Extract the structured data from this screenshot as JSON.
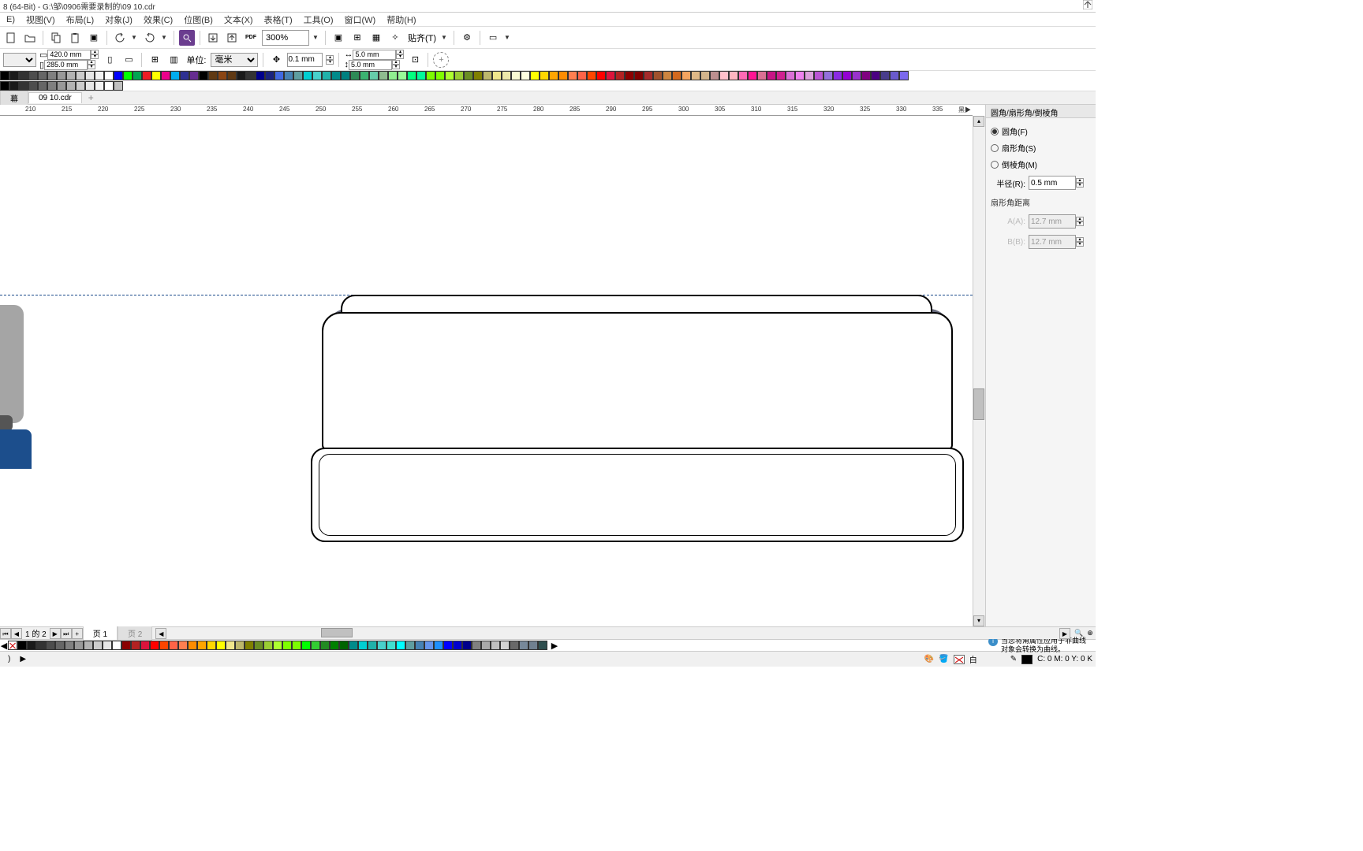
{
  "title": "8 (64-Bit) - G:\\邹\\0906需要录制的\\09 10.cdr",
  "menu": {
    "file": "E)",
    "view": "视图(V)",
    "layout": "布局(L)",
    "object": "对象(J)",
    "effects": "效果(C)",
    "bitmap": "位图(B)",
    "text": "文本(X)",
    "table": "表格(T)",
    "tools": "工具(O)",
    "window": "窗口(W)",
    "help": "帮助(H)"
  },
  "toolbar": {
    "zoom": "300%",
    "snap": "贴齐(T)",
    "pdf_label": "PDF"
  },
  "propbar": {
    "width": "420.0 mm",
    "height": "285.0 mm",
    "units_label": "单位:",
    "units": "毫米",
    "nudge": "0.1 mm",
    "dup_x": "5.0 mm",
    "dup_y": "5.0 mm"
  },
  "doc_tabs": {
    "tab1": "幕",
    "tab2": "09 10.cdr"
  },
  "ruler_ticks": [
    "210",
    "215",
    "220",
    "225",
    "230",
    "235",
    "240",
    "245",
    "250",
    "255",
    "260",
    "265",
    "270",
    "275",
    "280",
    "285",
    "290",
    "295",
    "300",
    "305",
    "310",
    "315",
    "320",
    "325",
    "330",
    "335"
  ],
  "ruler_end": "黑▶",
  "panel": {
    "title": "圆角/扇形角/倒棱角",
    "opt_round": "圆角(F)",
    "opt_scallop": "扇形角(S)",
    "opt_chamfer": "倒棱角(M)",
    "radius_label": "半径(R):",
    "radius": "0.5 mm",
    "scallop_dist": "扇形角距离",
    "a_label": "A(A):",
    "a_val": "12.7 mm",
    "b_label": "B(B):",
    "b_val": "12.7 mm"
  },
  "page_nav": {
    "count": "1 的 2",
    "page1": "页 1",
    "page2": "页 2"
  },
  "hint": "当您将角属性应用于非曲线对象会转换为曲线。",
  "status": {
    "cursor": ")",
    "arrow": "▶",
    "fill_label": "白",
    "outline_val": "C: 0 M: 0 Y: 0 K"
  },
  "top_palette_row1": [
    "#000000",
    "#1a1a1a",
    "#333333",
    "#4d4d4d",
    "#666666",
    "#808080",
    "#999999",
    "#b3b3b3",
    "#cccccc",
    "#e6e6e6",
    "#f2f2f2",
    "#ffffff",
    "#0000ff",
    "#00ff00",
    "#00a651",
    "#ed1c24",
    "#ffff00",
    "#ec008c",
    "#00aeef",
    "#2e3192",
    "#662d91",
    "#000000",
    "#603913",
    "#8b4513",
    "#603913",
    "#1a1a1a",
    "#333333",
    "#00008b",
    "#1a237e",
    "#4169e1",
    "#4682b4",
    "#5f9ea0",
    "#00ced1",
    "#48d1cc",
    "#20b2aa",
    "#008b8b",
    "#008080",
    "#2e8b57",
    "#3cb371",
    "#66cdaa",
    "#8fbc8f",
    "#90ee90",
    "#98fb98",
    "#00ff7f",
    "#00fa9a",
    "#7cfc00",
    "#7fff00",
    "#adff2f",
    "#9acd32",
    "#6b8e23",
    "#808000",
    "#bdb76b",
    "#f0e68c",
    "#eee8aa",
    "#fafad2",
    "#ffffe0",
    "#ffff00",
    "#ffd700",
    "#ffa500",
    "#ff8c00",
    "#ff7f50",
    "#ff6347",
    "#ff4500",
    "#ff0000",
    "#dc143c",
    "#b22222",
    "#8b0000",
    "#800000",
    "#a52a2a",
    "#a0522d",
    "#cd853f",
    "#d2691e",
    "#f4a460",
    "#deb887",
    "#d2b48c",
    "#bc8f8f",
    "#ffc0cb",
    "#ffb6c1",
    "#ff69b4",
    "#ff1493",
    "#db7093",
    "#c71585",
    "#d02090",
    "#da70d6",
    "#ee82ee",
    "#dda0dd",
    "#ba55d3",
    "#9370db",
    "#8a2be2",
    "#9400d3",
    "#9932cc",
    "#800080",
    "#4b0082",
    "#483d8b",
    "#6a5acd",
    "#7b68ee"
  ],
  "top_palette_row2": [
    "#000000",
    "#1a1a1a",
    "#333333",
    "#4d4d4d",
    "#666666",
    "#808080",
    "#999999",
    "#b3b3b3",
    "#cccccc",
    "#e6e6e6",
    "#f2f2f2",
    "#ffffff",
    "#c0c0c0"
  ],
  "bottom_palette": [
    "#000000",
    "#1a1a1a",
    "#333333",
    "#4d4d4d",
    "#666666",
    "#808080",
    "#999999",
    "#b3b3b3",
    "#cccccc",
    "#e6e6e6",
    "#ffffff",
    "#8b0000",
    "#b22222",
    "#dc143c",
    "#ff0000",
    "#ff4500",
    "#ff6347",
    "#ff7f50",
    "#ff8c00",
    "#ffa500",
    "#ffd700",
    "#ffff00",
    "#f0e68c",
    "#bdb76b",
    "#808000",
    "#6b8e23",
    "#9acd32",
    "#adff2f",
    "#7fff00",
    "#7cfc00",
    "#00ff00",
    "#32cd32",
    "#228b22",
    "#008000",
    "#006400",
    "#008b8b",
    "#00ced1",
    "#20b2aa",
    "#48d1cc",
    "#40e0d0",
    "#00ffff",
    "#5f9ea0",
    "#4682b4",
    "#6495ed",
    "#1e90ff",
    "#0000ff",
    "#0000cd",
    "#00008b",
    "#808080",
    "#a9a9a9",
    "#c0c0c0",
    "#d3d3d3",
    "#696969",
    "#778899",
    "#708090",
    "#2f4f4f"
  ]
}
